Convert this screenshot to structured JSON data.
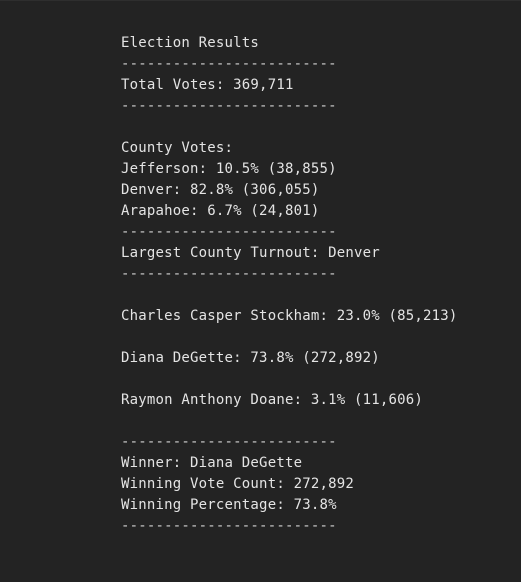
{
  "report": {
    "title": "Election Results",
    "separator": "-------------------------",
    "total_votes": "Total Votes: 369,711",
    "county_header": "County Votes:",
    "counties": [
      "Jefferson: 10.5% (38,855)",
      "Denver: 82.8% (306,055)",
      "Arapahoe: 6.7% (24,801)"
    ],
    "largest_county": "Largest County Turnout: Denver",
    "candidates": [
      "Charles Casper Stockham: 23.0% (85,213)",
      "Diana DeGette: 73.8% (272,892)",
      "Raymon Anthony Doane: 3.1% (11,606)"
    ],
    "winner": "Winner: Diana DeGette",
    "winning_vote_count": "Winning Vote Count: 272,892",
    "winning_percentage": "Winning Percentage: 73.8%"
  }
}
